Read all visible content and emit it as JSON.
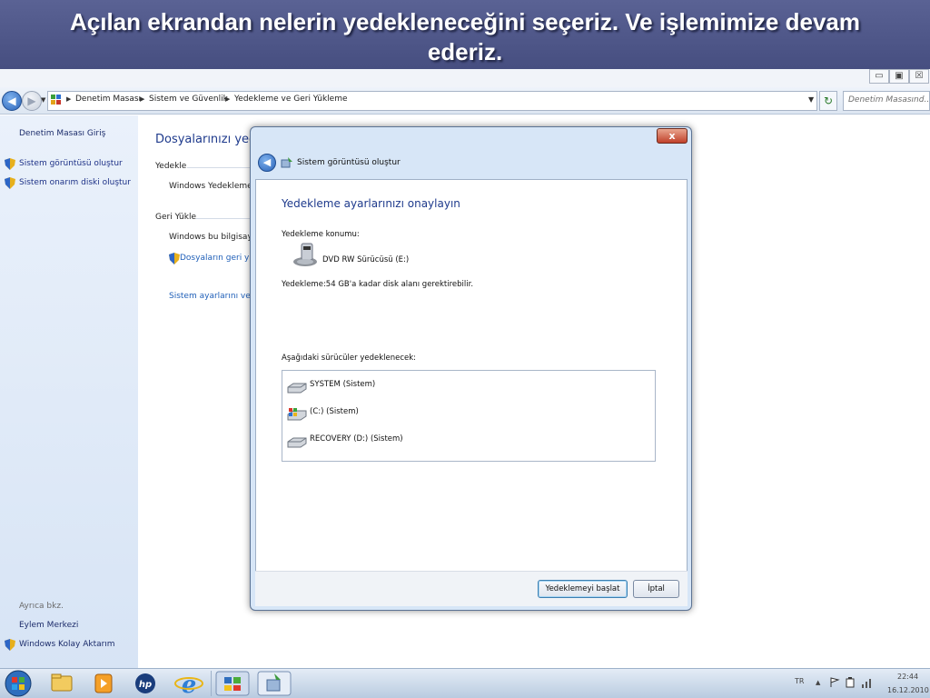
{
  "slide": {
    "caption_line1": "Açılan ekrandan nelerin yedekleneceğini seçeriz. Ve işlemimize devam",
    "caption_line2": "ederiz."
  },
  "window_controls": [
    "▭",
    "▣",
    "☒"
  ],
  "breadcrumbs": [
    "Denetim Masası",
    "Sistem ve Güvenlik",
    "Yedekleme ve Geri Yükleme"
  ],
  "search": {
    "placeholder": "Denetim Masasınd..."
  },
  "left_pane": {
    "home": "Denetim Masası Giriş",
    "tasks": [
      "Sistem görüntüsü oluştur",
      "Sistem onarım diski oluştur"
    ],
    "see_also_label": "Ayrıca bkz.",
    "see_also": [
      "Eylem Merkezi",
      "Windows Kolay Aktarım"
    ]
  },
  "main": {
    "title": "Dosyalarınızı yedekl",
    "section_backup": "Yedekle",
    "backup_status": "Windows Yedekleme k",
    "section_restore": "Geri Yükle",
    "restore_text": "Windows bu bilgisaya",
    "restore_link": "Dosyaların geri yük",
    "system_link": "Sistem ayarlarını veya"
  },
  "dialog": {
    "close_label": "x",
    "title": "Sistem görüntüsü oluştur",
    "heading": "Yedekleme ayarlarınızı onaylayın",
    "location_label": "Yedekleme konumu:",
    "location_value": "DVD RW Sürücüsü (E:)",
    "size_note": "Yedekleme:54 GB'a kadar disk alanı gerektirebilir.",
    "drives_label": "Aşağıdaki sürücüler yedeklenecek:",
    "drives": [
      "SYSTEM (Sistem)",
      "(C:) (Sistem)",
      "RECOVERY (D:) (Sistem)"
    ],
    "start_button": "Yedeklemeyi başlat",
    "cancel_button": "İptal"
  },
  "taskbar": {
    "language": "TR",
    "time": "22:44",
    "date": "16.12.2010"
  },
  "colors": {
    "banner": "#4b5385",
    "link": "#1e3287",
    "heading": "#1e3a8c"
  }
}
